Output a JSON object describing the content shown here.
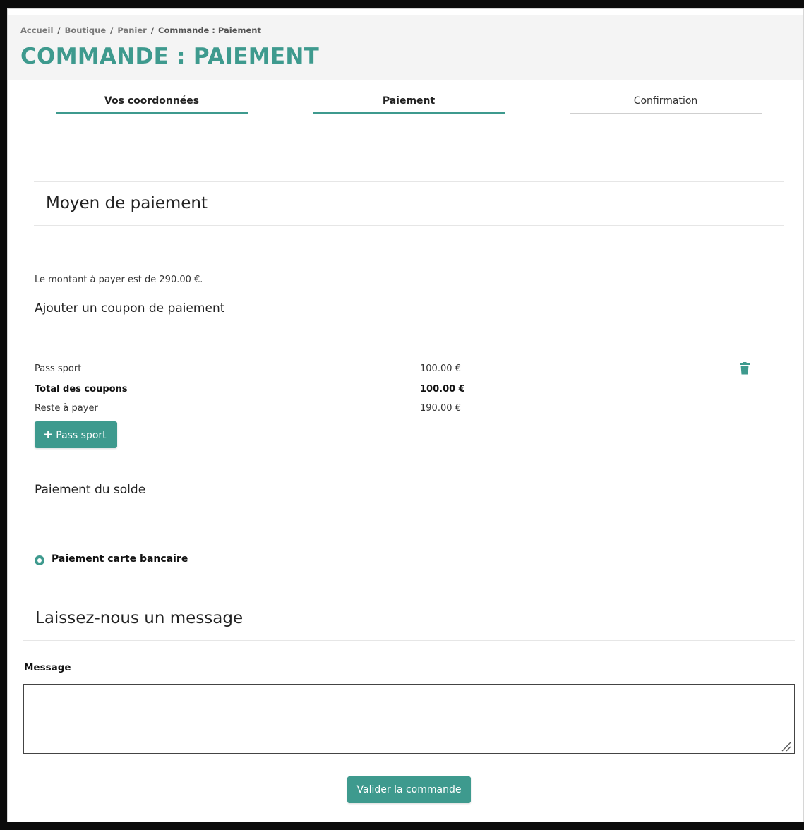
{
  "breadcrumb": [
    {
      "label": "Accueil"
    },
    {
      "label": "Boutique"
    },
    {
      "label": "Panier"
    },
    {
      "label": "Commande : Paiement"
    }
  ],
  "breadcrumb_separator": "/",
  "page_title": "COMMANDE : PAIEMENT",
  "steps": [
    {
      "label": "Vos coordonnées",
      "state": "done"
    },
    {
      "label": "Paiement",
      "state": "active"
    },
    {
      "label": "Confirmation",
      "state": "pending"
    }
  ],
  "payment": {
    "section_title": "Moyen de paiement",
    "amount_text": "Le montant à payer est de 290.00 €.",
    "coupon_title": "Ajouter un coupon de paiement",
    "coupons": [
      {
        "name": "Pass sport",
        "amount": "100.00 €",
        "icon": "trash-icon"
      }
    ],
    "total_label": "Total des coupons",
    "total_amount": "100.00 €",
    "remaining_label": "Reste à payer",
    "remaining_amount": "190.00 €",
    "add_button_icon": "plus-icon",
    "add_button_label": "Pass sport",
    "balance_title": "Paiement du solde",
    "method_label": "Paiement carte bancaire"
  },
  "message": {
    "section_title": "Laissez-nous un message",
    "field_label": "Message",
    "value": ""
  },
  "submit_label": "Valider la commande",
  "colors": {
    "accent": "#3e9a8e",
    "background": "#0b0b0b",
    "header_bg": "#f4f4f4"
  }
}
